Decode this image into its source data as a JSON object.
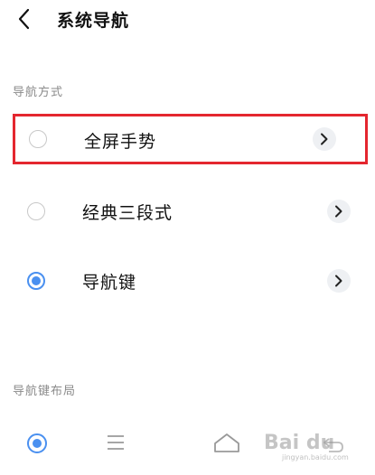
{
  "header": {
    "title": "系统导航",
    "back_icon": "chevron-left-icon"
  },
  "sections": {
    "nav_mode_label": "导航方式",
    "layout_label": "导航键布局"
  },
  "options": [
    {
      "label": "全屏手势",
      "selected": false,
      "highlighted": true
    },
    {
      "label": "经典三段式",
      "selected": false,
      "highlighted": false
    },
    {
      "label": "导航键",
      "selected": true,
      "highlighted": false
    }
  ],
  "layout_row": {
    "selected": true,
    "icons": [
      "menu-icon",
      "home-icon",
      "back-icon"
    ]
  },
  "watermark": {
    "text": "Bai du",
    "subtext": "jingyan.baidu.com"
  },
  "colors": {
    "accent": "#4a90f0",
    "highlight_border": "#e4262f",
    "section_text": "#8a8a8a",
    "chevron_bg": "#eef0f3"
  }
}
